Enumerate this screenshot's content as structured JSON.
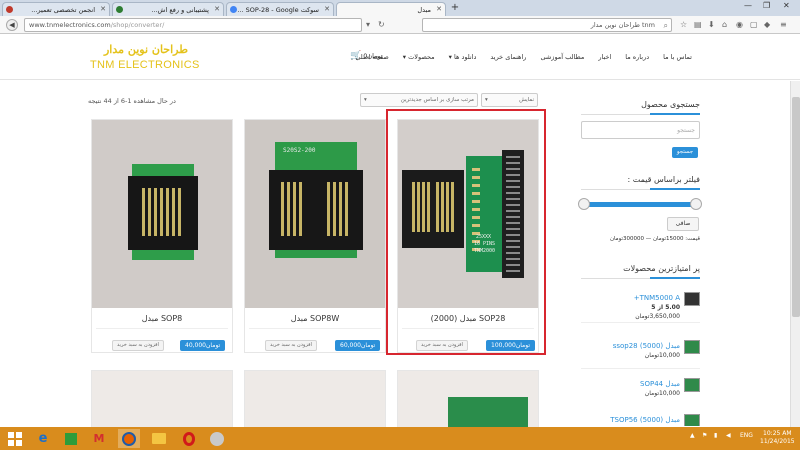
{
  "browser": {
    "tabs": [
      {
        "label": "انجمن تخصصی تعمیر..."
      },
      {
        "label": "پشتیبانی و رفع اش..."
      },
      {
        "label": "سوکت SOP-28 - Google ..."
      },
      {
        "label": "مبدل"
      }
    ],
    "url_host": "www.tnmelectronics.com",
    "url_path": "/shop/converter/",
    "search_text": "tnm طراحان نوین مدار"
  },
  "site": {
    "logo_fa": "طراحان نوین مدار",
    "logo_en": "TNM ELECTRONICS",
    "menu": [
      "صفحه اصلی",
      "محصولات",
      "دانلود ها",
      "راهنمای خرید",
      "مطالب آموزشی",
      "اخبار",
      "درباره ما",
      "تماس با ما"
    ],
    "cart_amount": "0تومان"
  },
  "shop": {
    "results_text": "در حال مشاهده 1-6 از 44 نتیجه",
    "sort_options": [
      "مرتب سازی بر اساس جدیدترین",
      "نمایش"
    ],
    "products": [
      {
        "title": "مبدل (2000) SOP28",
        "price": "100,000تومان",
        "cart_label": "افزودن به سبد خرید",
        "pcb_text_1": "25XXX",
        "pcb_text_2": "16 PINS",
        "pcb_text_3": "TNM2000"
      },
      {
        "title": "مبدل SOP8W",
        "price": "60,000تومان",
        "cart_label": "افزودن به سبد خرید",
        "pcb_text_1": "S20S2-200"
      },
      {
        "title": "مبدل SOP8",
        "price": "40,000تومان",
        "cart_label": "افزودن به سبد خرید"
      }
    ]
  },
  "sidebar": {
    "search_heading": "جستجوی محصول",
    "search_placeholder": "جستجو",
    "search_button": "جستجو",
    "filter_heading": "فیلتر براساس قیمت :",
    "filter_button": "صافی",
    "price_range": "قیمت: 15000تومان — 300000تومان",
    "top_heading": "پر امتیازترین محصولات",
    "top_products": [
      {
        "name": "TNM5000 A+",
        "rating": "5.00 از 5",
        "price": "3,650,000تومان"
      },
      {
        "name": "مبدل (5000) ssop28",
        "price": "10,000تومان"
      },
      {
        "name": "مبدل SOP44",
        "price": "10,000تومان"
      },
      {
        "name": "مبدل (5000) TSOP56"
      }
    ]
  },
  "taskbar": {
    "lang": "ENG",
    "time": "10:25 AM",
    "date": "11/24/2015"
  },
  "colors": {
    "accent_blue": "#2b90d9",
    "logo_yellow": "#e4c21a",
    "highlight_red": "#d7262f",
    "taskbar_orange": "#d98c1d"
  }
}
